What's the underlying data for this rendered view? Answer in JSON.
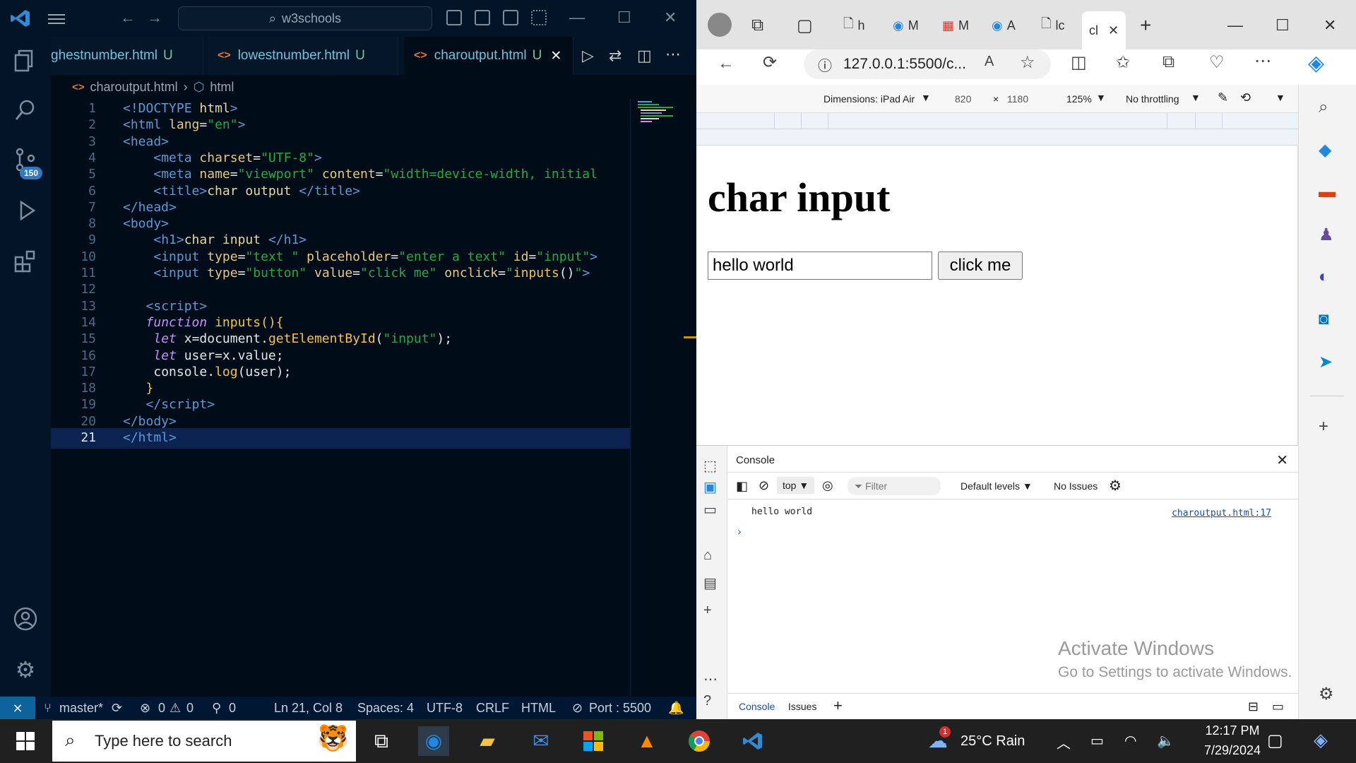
{
  "vscode": {
    "search_text": "w3schools",
    "tabs": [
      {
        "name": "ghestnumber.html",
        "status": "U"
      },
      {
        "name": "lowestnumber.html",
        "status": "U"
      },
      {
        "name": "charoutput.html",
        "status": "U"
      }
    ],
    "breadcrumb": {
      "file": "charoutput.html",
      "symbol": "html"
    },
    "scm_badge": "150",
    "code_lines": [
      "1",
      "2",
      "3",
      "4",
      "5",
      "6",
      "7",
      "8",
      "9",
      "10",
      "11",
      "12",
      "13",
      "14",
      "15",
      "16",
      "17",
      "18",
      "19",
      "20",
      "21"
    ],
    "status": {
      "branch": "master*",
      "errors": "0",
      "warnings": "0",
      "ports": "0",
      "position": "Ln 21, Col 8",
      "spaces": "Spaces: 4",
      "encoding": "UTF-8",
      "eol": "CRLF",
      "language": "HTML",
      "port": "Port : 5500"
    }
  },
  "browser": {
    "tabs": [
      "h",
      "M",
      "M",
      "A",
      "lc",
      "cl"
    ],
    "url": "127.0.0.1:5500/c...",
    "device": {
      "label": "Dimensions: iPad Air",
      "width": "820",
      "height": "1180",
      "zoom": "125%",
      "throttle": "No throttling"
    },
    "page": {
      "heading": "char input",
      "input_value": "hello world",
      "button_label": "click me"
    },
    "console": {
      "title": "Console",
      "context": "top",
      "filter_placeholder": "Filter",
      "levels": "Default levels",
      "issues": "No Issues",
      "log_message": "hello world",
      "log_source": "charoutput.html:17",
      "bottom_tabs": [
        "Console",
        "Issues"
      ]
    },
    "activate": {
      "title": "Activate Windows",
      "subtitle": "Go to Settings to activate Windows."
    }
  },
  "taskbar": {
    "search_placeholder": "Type here to search",
    "weather": "25°C  Rain",
    "weather_badge": "1",
    "time": "12:17 PM",
    "date": "7/29/2024"
  },
  "colors": {
    "vscode_bg": "#000c18",
    "accent": "#0e639c",
    "string": "#22aa44",
    "tag": "#5c99d6"
  }
}
